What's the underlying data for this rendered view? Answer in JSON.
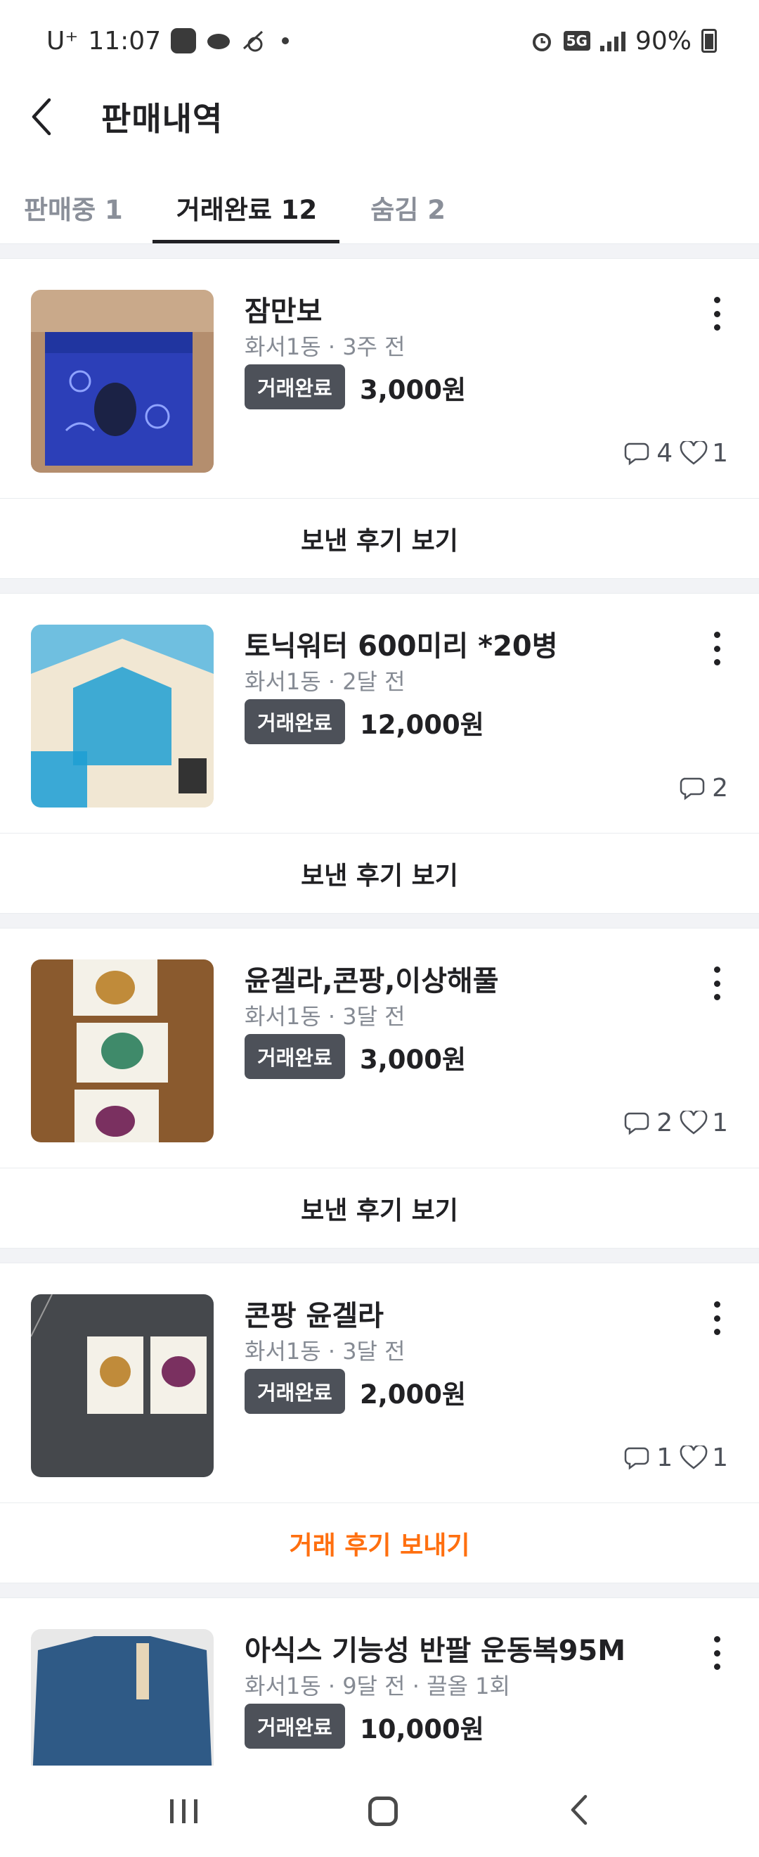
{
  "status_bar": {
    "carrier": "U⁺",
    "time": "11:07",
    "network": "5G",
    "battery": "90%"
  },
  "header": {
    "title": "판매내역"
  },
  "tabs": [
    {
      "label": "판매중 1"
    },
    {
      "label": "거래완료 12"
    },
    {
      "label": "숨김 2"
    }
  ],
  "items": [
    {
      "title": "잠만보",
      "meta": "화서1동 · 3주 전",
      "badge": "거래완료",
      "price": "3,000원",
      "comments": "4",
      "likes": "1",
      "action": "보낸 후기 보기"
    },
    {
      "title": "토닉워터 600미리 *20병",
      "meta": "화서1동 · 2달 전",
      "badge": "거래완료",
      "price": "12,000원",
      "comments": "2",
      "likes": "",
      "action": "보낸 후기 보기"
    },
    {
      "title": "윤겔라,콘팡,이상해풀",
      "meta": "화서1동 · 3달 전",
      "badge": "거래완료",
      "price": "3,000원",
      "comments": "2",
      "likes": "1",
      "action": "보낸 후기 보기"
    },
    {
      "title": "콘팡 윤겔라",
      "meta": "화서1동 · 3달 전",
      "badge": "거래완료",
      "price": "2,000원",
      "comments": "1",
      "likes": "1",
      "action": "거래 후기 보내기"
    },
    {
      "title": "아식스 기능성 반팔 운동복95M",
      "meta": "화서1동 · 9달 전 · 끌올 1회",
      "badge": "거래완료",
      "price": "10,000원"
    }
  ],
  "colors": {
    "accent_orange": "#ff6f0f",
    "badge_bg": "#4d5159",
    "divider": "#f2f3f6"
  }
}
